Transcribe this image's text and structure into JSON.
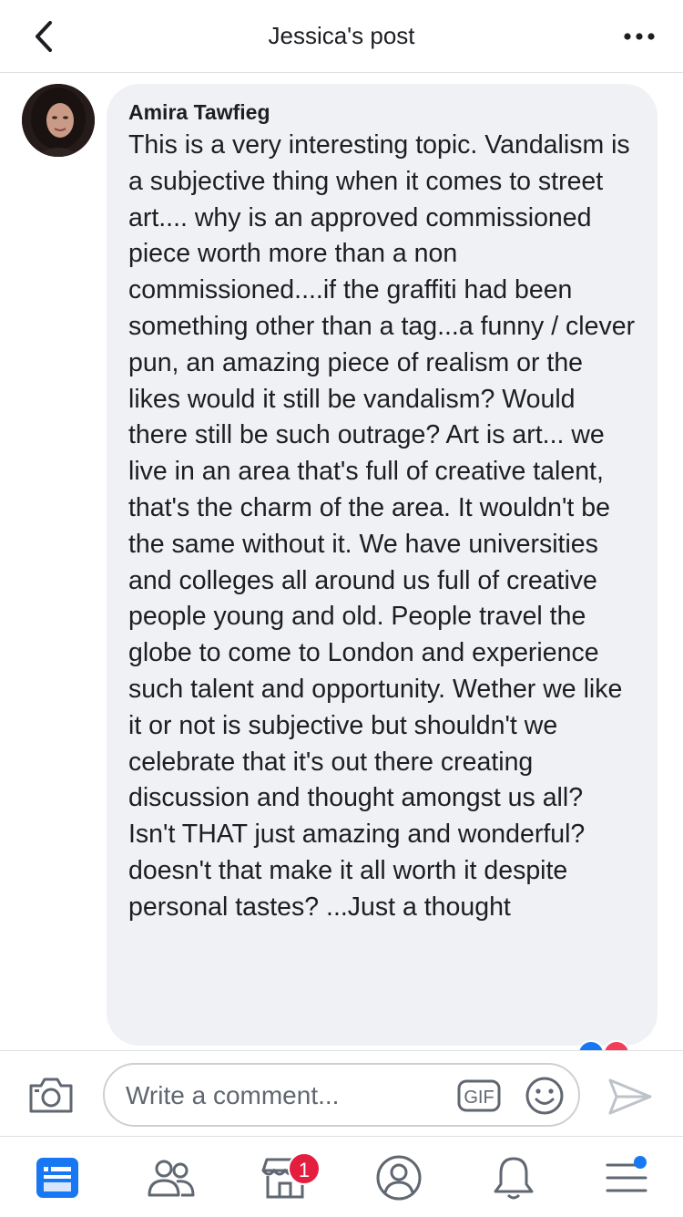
{
  "header": {
    "title": "Jessica's post"
  },
  "comment": {
    "author": "Amira Tawfieg",
    "text": "This is a very interesting topic. Vandalism is a subjective thing when it comes to street art.... why is an approved commissioned piece worth more than a non commissioned....if the graffiti had been something other than a tag...a funny / clever pun, an amazing piece of realism or the likes would it still be vandalism? Would there still be such outrage? Art is art... we live in an area that's full of creative talent, that's the charm of the area. It wouldn't be the same without it. We have universities and colleges all around us full of creative people young and old. People travel the globe to come to London and experience such talent and opportunity. Wether we like it or not is subjective but shouldn't we celebrate that it's out there creating discussion and thought amongst us all? Isn't THAT just amazing and wonderful? doesn't that make it all worth it despite personal tastes? ...Just a thought"
  },
  "composer": {
    "placeholder": "Write a comment...",
    "gif_label": "GIF"
  },
  "tabbar": {
    "marketplace_badge": "1"
  },
  "colors": {
    "accent": "#1877f2",
    "badge": "#e41e3f",
    "bubble": "#f0f1f4"
  }
}
